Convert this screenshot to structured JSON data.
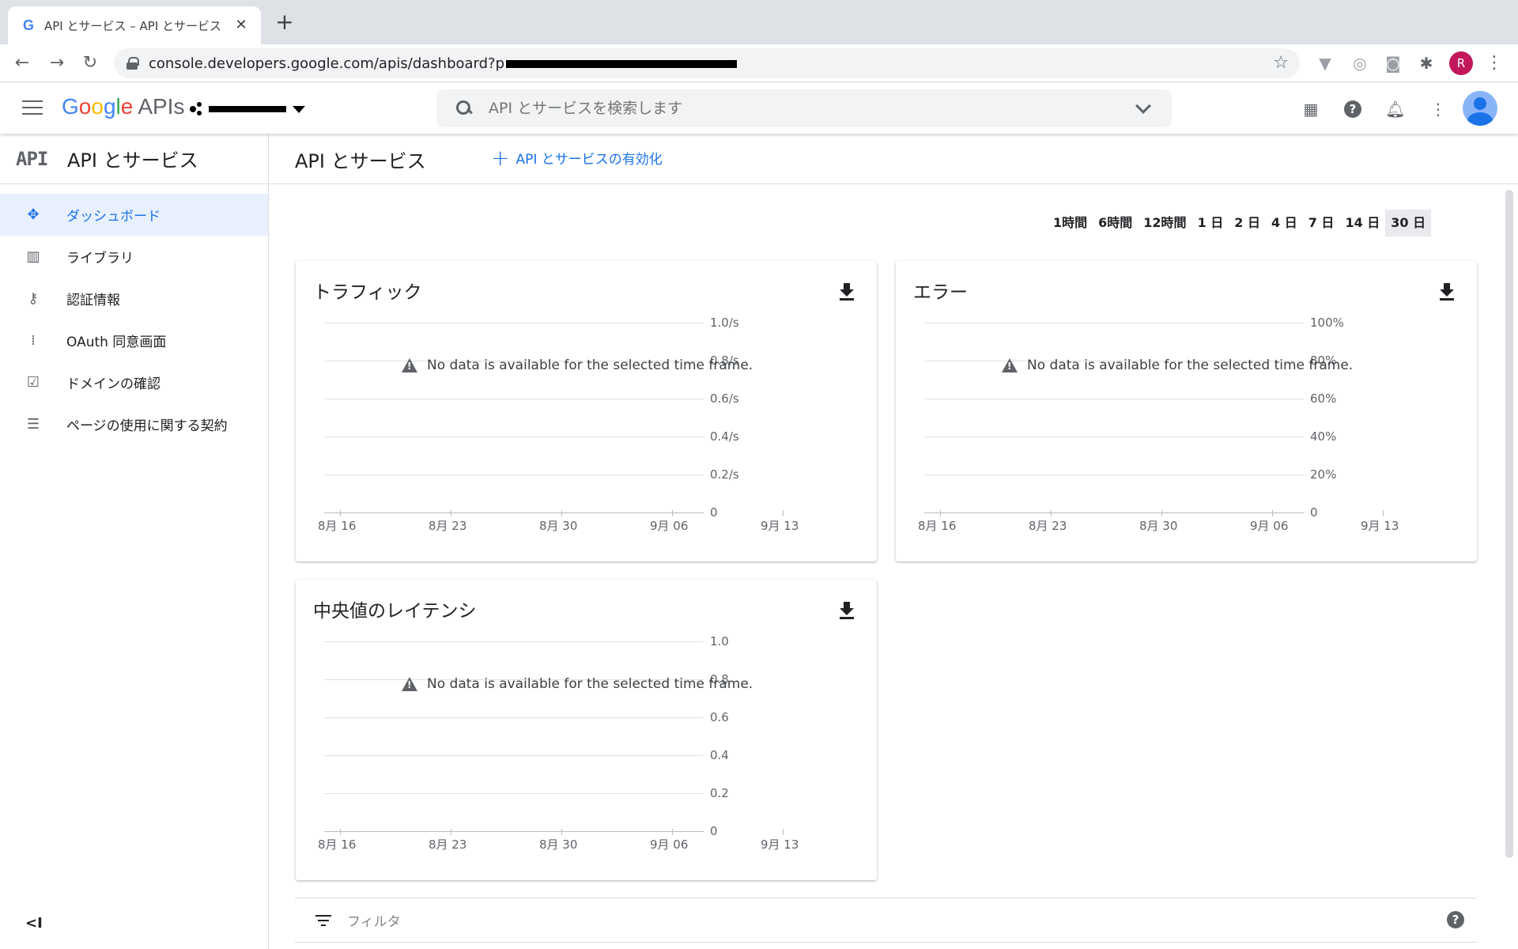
{
  "browser": {
    "tab_title": "API とサービス – API とサービス",
    "tab_favicon": "G",
    "url": "console.developers.google.com/apis/dashboard?p",
    "profile_initial": "R",
    "profile_color": "#c2185b"
  },
  "header": {
    "logo_letters": [
      "G",
      "o",
      "o",
      "g",
      "l",
      "e"
    ],
    "logo_suffix": "APIs",
    "search_placeholder": "API とサービスを検索します"
  },
  "sidebar": {
    "badge": "API",
    "title": "API とサービス",
    "items": [
      {
        "label": "ダッシュボード",
        "icon": "dashboard-icon",
        "active": true
      },
      {
        "label": "ライブラリ",
        "icon": "library-icon",
        "active": false
      },
      {
        "label": "認証情報",
        "icon": "key-icon",
        "active": false
      },
      {
        "label": "OAuth 同意画面",
        "icon": "consent-icon",
        "active": false
      },
      {
        "label": "ドメインの確認",
        "icon": "checkbox-icon",
        "active": false
      },
      {
        "label": "ページの使用に関する契約",
        "icon": "settings-list-icon",
        "active": false
      }
    ],
    "collapse_label": "<I"
  },
  "main": {
    "title": "API とサービス",
    "enable_button": "API とサービスの有効化",
    "time_ranges": [
      "1時間",
      "6時間",
      "12時間",
      "1 日",
      "2 日",
      "4 日",
      "7 日",
      "14 日",
      "30 日"
    ],
    "selected_range": "30 日",
    "filter_placeholder": "フィルタ"
  },
  "accent_color": "#1a73e8",
  "chart_data": [
    {
      "type": "line",
      "title": "トラフィック",
      "x_ticks": [
        "8月 16",
        "8月 23",
        "8月 30",
        "9月 06",
        "9月 13"
      ],
      "y_ticks": [
        "1.0/s",
        "0.8/s",
        "0.6/s",
        "0.4/s",
        "0.2/s",
        "0"
      ],
      "ylim": [
        0,
        1.0
      ],
      "series": [],
      "annotation": "No data is available for the selected time frame."
    },
    {
      "type": "line",
      "title": "エラー",
      "x_ticks": [
        "8月 16",
        "8月 23",
        "8月 30",
        "9月 06",
        "9月 13"
      ],
      "y_ticks": [
        "100%",
        "80%",
        "60%",
        "40%",
        "20%",
        "0"
      ],
      "ylim": [
        0,
        100
      ],
      "series": [],
      "annotation": "No data is available for the selected time frame."
    },
    {
      "type": "line",
      "title": "中央値のレイテンシ",
      "x_ticks": [
        "8月 16",
        "8月 23",
        "8月 30",
        "9月 06",
        "9月 13"
      ],
      "y_ticks": [
        "1.0",
        "0.8",
        "0.6",
        "0.4",
        "0.2",
        "0"
      ],
      "ylim": [
        0,
        1.0
      ],
      "series": [],
      "annotation": "No data is available for the selected time frame."
    }
  ]
}
